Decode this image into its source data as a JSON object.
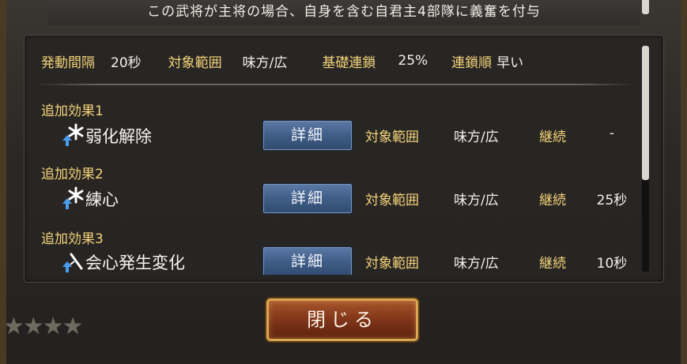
{
  "description": "この武将が主将の場合、自身を含む自君主4部隊に義奮を付与",
  "summary": {
    "interval_label": "発動間隔",
    "interval_value": "20秒",
    "target_label": "対象範囲",
    "target_value": "味方/広",
    "base_chain_label": "基礎連鎖",
    "base_chain_value": "25%",
    "chain_order_label": "連鎖順",
    "chain_order_value": "早い"
  },
  "effects": [
    {
      "header": "追加効果1",
      "name": "弱化解除",
      "icon": "asterisk-up-icon",
      "detail_label": "詳細",
      "target_label": "対象範囲",
      "target_value": "味方/広",
      "duration_label": "継続",
      "duration_value": "-"
    },
    {
      "header": "追加効果2",
      "name": "練心",
      "icon": "asterisk-up-icon",
      "detail_label": "詳細",
      "target_label": "対象範囲",
      "target_value": "味方/広",
      "duration_label": "継続",
      "duration_value": "25秒"
    },
    {
      "header": "追加効果3",
      "name": "会心発生変化",
      "icon": "sword-up-icon",
      "detail_label": "詳細",
      "target_label": "対象範囲",
      "target_value": "味方/広",
      "duration_label": "継続",
      "duration_value": "10秒"
    }
  ],
  "close_label": "閉じる",
  "colors": {
    "label_gold": "#f3d37a",
    "value_white": "#f2f0ea",
    "detail_button": "#3f5d87",
    "close_button": "#7d3318"
  }
}
